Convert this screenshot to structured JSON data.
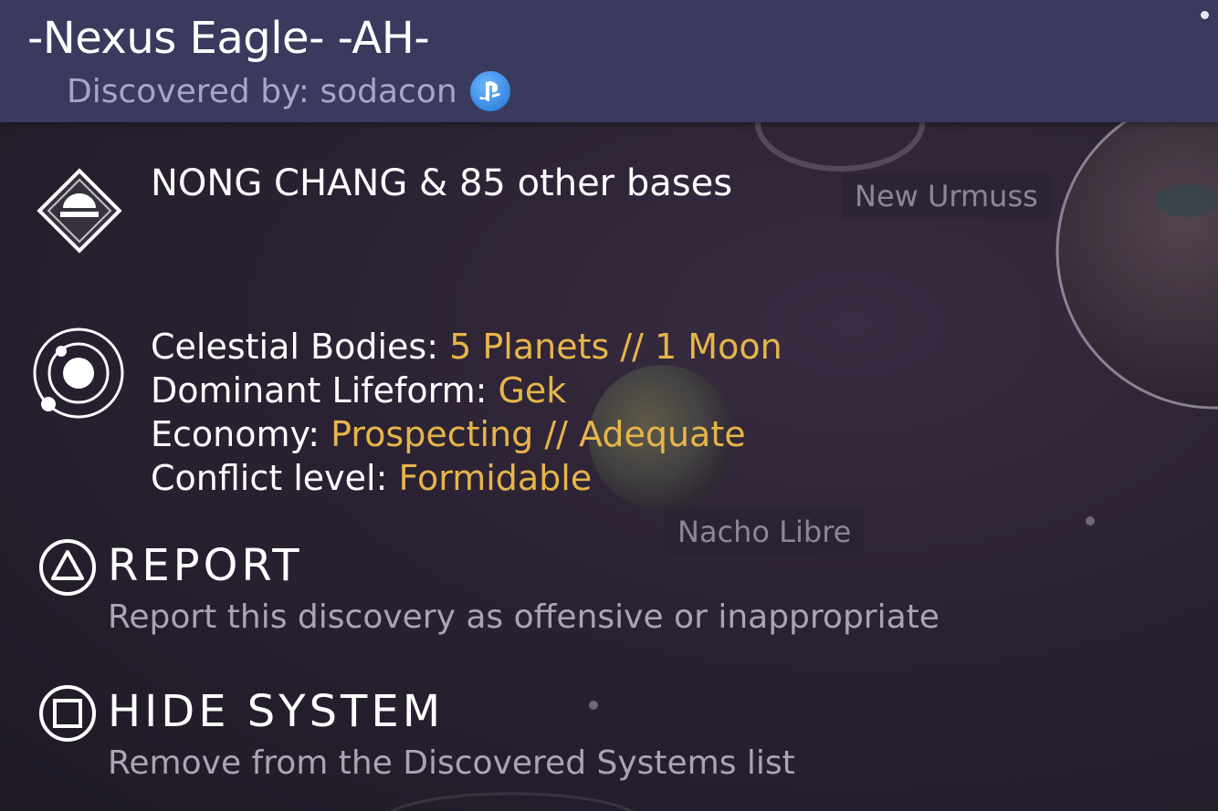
{
  "header": {
    "title": "-Nexus Eagle- -AH-",
    "discovered_by": "Discovered by: sodacon",
    "platform_icon": "playstation-icon"
  },
  "map_labels": {
    "label_1": "New Urmuss",
    "label_2": "Nacho Libre"
  },
  "bases": {
    "icon": "base-icon",
    "text": "NONG CHANG & 85 other bases"
  },
  "system_info": {
    "icon": "solar-system-icon",
    "rows": [
      {
        "label": "Celestial Bodies: ",
        "value": "5 Planets // 1 Moon"
      },
      {
        "label": "Dominant Lifeform: ",
        "value": "Gek"
      },
      {
        "label": "Economy: ",
        "value": "Prospecting // Adequate"
      },
      {
        "label": "Conflict level: ",
        "value": "Formidable"
      }
    ]
  },
  "actions": {
    "report": {
      "icon": "triangle-button-icon",
      "title": "REPORT",
      "description": "Report this discovery as offensive or inappropriate"
    },
    "hide": {
      "icon": "square-button-icon",
      "title": "HIDE SYSTEM",
      "description": "Remove from the Discovered Systems list"
    }
  },
  "colors": {
    "header_bg": "#3a3a5e",
    "value_accent": "#e6b54a",
    "muted_text": "#aaa4b4"
  }
}
